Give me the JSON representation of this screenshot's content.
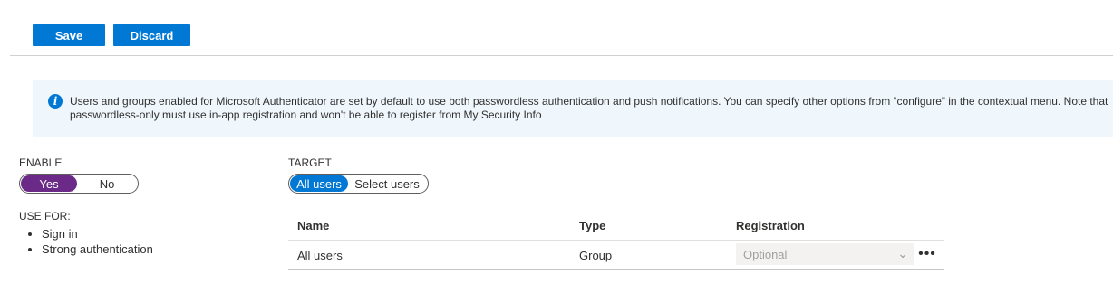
{
  "toolbar": {
    "save_label": "Save",
    "discard_label": "Discard"
  },
  "info": {
    "icon": "info-icon",
    "line1": "Users and groups enabled for Microsoft Authenticator are set by default to use both passwordless authentication and push notifications. You can specify other options from “configure” in the contextual menu. Note that",
    "line2": "passwordless-only must use in-app registration and won't be able to register from My Security Info"
  },
  "enable": {
    "label": "ENABLE",
    "yes": "Yes",
    "no": "No",
    "selected": "Yes",
    "accent": "#6b2a87"
  },
  "target": {
    "label": "TARGET",
    "all": "All users",
    "select": "Select users",
    "selected": "All users",
    "accent": "#0078d4"
  },
  "use_for": {
    "label": "USE FOR:",
    "items": [
      "Sign in",
      "Strong authentication"
    ]
  },
  "table": {
    "headers": [
      "Name",
      "Type",
      "Registration"
    ],
    "rows": [
      {
        "name": "All users",
        "type": "Group",
        "registration": "Optional"
      }
    ]
  }
}
